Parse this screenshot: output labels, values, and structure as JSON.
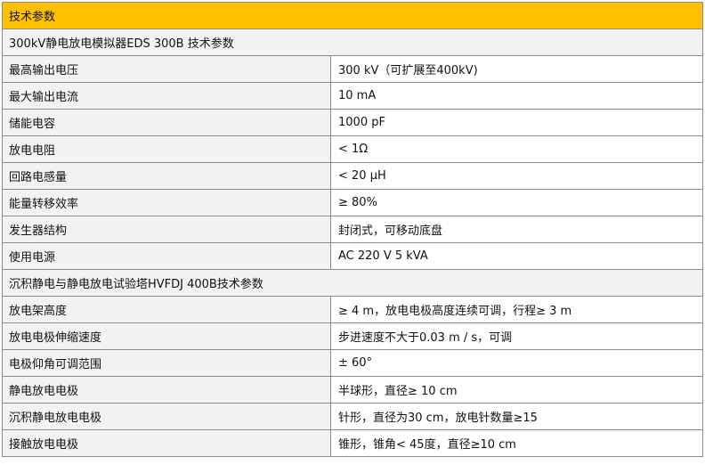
{
  "title": "技术参数",
  "sections": [
    {
      "heading": "300kV静电放电模拟器EDS 300B 技术参数",
      "rows": [
        {
          "name": "最高输出电压",
          "value": "300 kV（可扩展至400kV)"
        },
        {
          "name": "最大输出电流",
          "value": "10 mA"
        },
        {
          "name": "储能电容",
          "value": "1000 pF"
        },
        {
          "name": "放电电阻",
          "value": "< 1Ω"
        },
        {
          "name": "回路电感量",
          "value": "< 20 μH"
        },
        {
          "name": "能量转移效率",
          "value": "≥ 80%"
        },
        {
          "name": "发生器结构",
          "value": "封闭式，可移动底盘"
        },
        {
          "name": "使用电源",
          "value": "AC 220 V 5 kVA"
        }
      ]
    },
    {
      "heading": "沉积静电与静电放电试验塔HVFDJ 400B技术参数",
      "rows": [
        {
          "name": "放电架高度",
          "value": "≥ 4 m，放电电极高度连续可调，行程≥ 3 m"
        },
        {
          "name": "放电电极伸缩速度",
          "value": "步进速度不大于0.03 m / s，可调"
        },
        {
          "name": "电极仰角可调范围",
          "value": "± 60°"
        },
        {
          "name": "静电放电电极",
          "value": "半球形，直径≥ 10 cm"
        },
        {
          "name": "沉积静电放电电极",
          "value": "针形，直径为30 cm，放电针数量≥15"
        },
        {
          "name": "接触放电电极",
          "value": "锥形，锥角< 45度，直径≥10 cm"
        }
      ]
    }
  ]
}
